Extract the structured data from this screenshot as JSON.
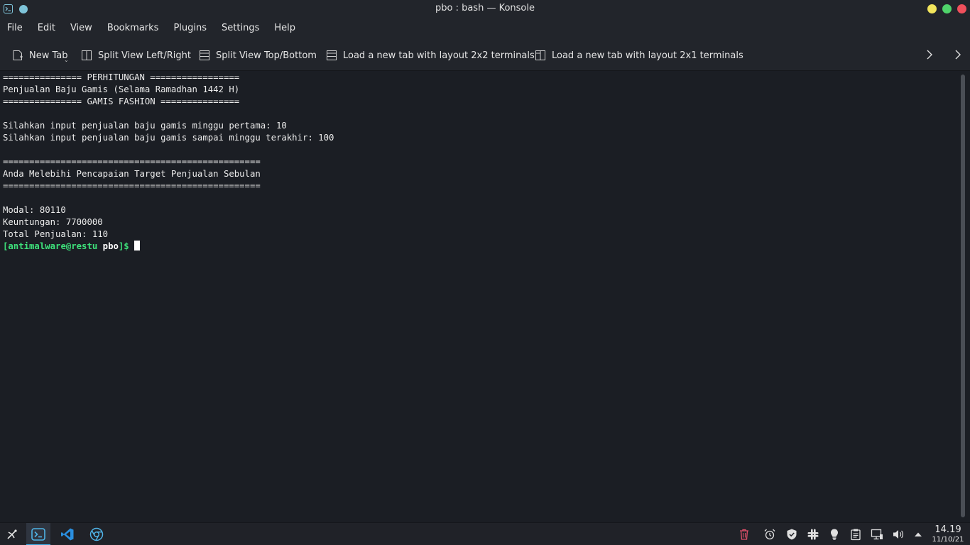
{
  "window": {
    "title": "pbo : bash — Konsole"
  },
  "menu": {
    "items": [
      "File",
      "Edit",
      "View",
      "Bookmarks",
      "Plugins",
      "Settings",
      "Help"
    ]
  },
  "toolbar": {
    "new_tab": "New Tab",
    "split_lr": "Split View Left/Right",
    "split_tb": "Split View Top/Bottom",
    "layout_2x2": "Load a new tab with layout 2x2 terminals",
    "layout_2x1": "Load a new tab with layout 2x1 terminals"
  },
  "terminal": {
    "lines": [
      "=============== PERHITUNGAN =================",
      "Penjualan Baju Gamis (Selama Ramadhan 1442 H)",
      "=============== GAMIS FASHION ===============",
      "",
      "Silahkan input penjualan baju gamis minggu pertama: 10",
      "Silahkan input penjualan baju gamis sampai minggu terakhir: 100",
      "",
      "=================================================",
      "Anda Melebihi Pencapaian Target Penjualan Sebulan",
      "=================================================",
      "",
      "Modal: 80110",
      "Keuntungan: 7700000",
      "Total Penjualan: 110"
    ],
    "prompt": {
      "open": "[",
      "user_host": "antimalware@restu",
      "dir": " pbo",
      "close": "]$ "
    }
  },
  "taskbar": {
    "apps": [
      "launcher-icon",
      "konsole-icon",
      "vscode-icon",
      "chrome-icon"
    ],
    "tray": [
      "trash-icon",
      "alarm-icon",
      "shield-icon",
      "slack-icon",
      "lightbulb-icon",
      "clipboard-icon",
      "network-icon",
      "volume-icon",
      "tray-expand-icon"
    ],
    "time": "14.19",
    "date": "11/10/21"
  },
  "colors": {
    "background": "#1b1e24",
    "chrome": "#22252b",
    "prompt_user": "#3de07a",
    "accent": "#3daee9"
  }
}
